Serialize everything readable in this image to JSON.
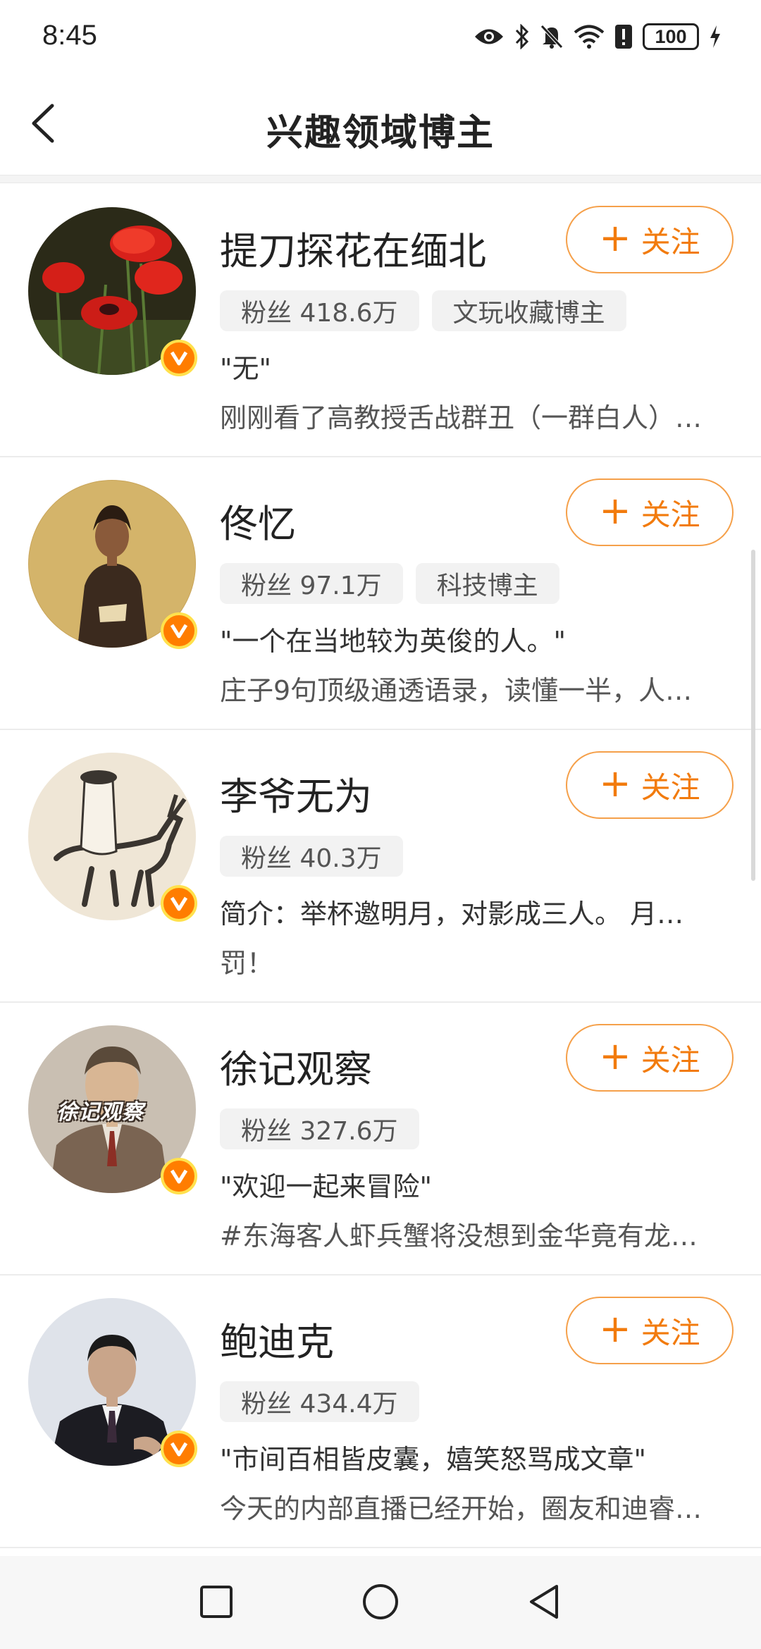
{
  "status_bar": {
    "time": "8:45",
    "battery": "100",
    "icons": [
      "eye-icon",
      "bluetooth-icon",
      "mute-icon",
      "wifi-icon",
      "alert-icon",
      "battery-icon",
      "charging-icon"
    ]
  },
  "header": {
    "title": "兴趣领域博主",
    "back_icon": "back-arrow-icon"
  },
  "follow_label": "关注",
  "accent_color": "#f27b0d",
  "badge_color": "#ff7d00",
  "bloggers": [
    {
      "name": "提刀探花在缅北",
      "fans": "粉丝 418.6万",
      "tag": "文玩收藏博主",
      "line1": "\"无\"",
      "line2": "刚刚看了高教授舌战群丑（一群白人）…"
    },
    {
      "name": "佟忆",
      "fans": "粉丝 97.1万",
      "tag": "科技博主",
      "line1": "\"一个在当地较为英俊的人。\"",
      "line2": "庄子9句顶级通透语录，读懂一半，人…"
    },
    {
      "name": "李爷无为",
      "fans": "粉丝 40.3万",
      "tag": "",
      "line1": "简介：举杯邀明月，对影成三人。 月…",
      "line2": "罚！"
    },
    {
      "name": "徐记观察",
      "fans": "粉丝 327.6万",
      "tag": "",
      "line1": "\"欢迎一起来冒险\"",
      "line2": "#东海客人虾兵蟹将没想到金华竟有龙…",
      "avatar_text": "徐记观察"
    },
    {
      "name": "鲍迪克",
      "fans": "粉丝 434.4万",
      "tag": "",
      "line1": "\"市间百相皆皮囊，嬉笑怒骂成文章\"",
      "line2": "今天的内部直播已经开始，圈友和迪睿…"
    }
  ],
  "nav_bar": {
    "icons": [
      "recent-apps-icon",
      "home-icon",
      "back-icon"
    ]
  }
}
